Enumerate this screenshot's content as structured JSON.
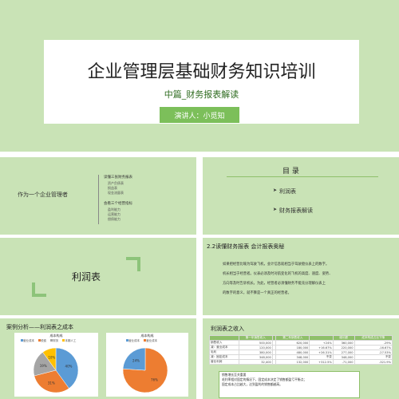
{
  "colors": {
    "slide_bg": "#c9e3b6",
    "title_band": "#a9d08e",
    "accent_green": "#7cbf5a",
    "pie_blue": "#5b9bd5",
    "pie_orange": "#ed7d31",
    "pie_gray": "#a5a5a5",
    "pie_yellow": "#ffc000"
  },
  "title_slide": {
    "title": "企业管理层基础财务知识培训",
    "subtitle": "中篇_财务报表解读",
    "presenter": "演讲人：小觅知"
  },
  "slide2": {
    "heading": "作为一个企业管理者",
    "box1_title": "读懂三张财务报表",
    "box1_items": [
      "资产负债表",
      "损益表",
      "现金流量表"
    ],
    "box2_title": "会看三个经营指标",
    "box2_items": [
      "盈利能力",
      "运营能力",
      "偿债能力"
    ]
  },
  "slide3": {
    "title": "目  录",
    "items": [
      "利润表",
      "财务报表解读"
    ]
  },
  "slide4": {
    "label": "利润表"
  },
  "slide5": {
    "title": "2.2读懂财务报表  会计报表奥秘",
    "paragraphs": [
      "如果把经营比喻为驾驶飞机，会计信息就相当于驾驶舱仪表上的数字。",
      "机长相当于经营者。仪表必须及时对航变化的飞机的高度、速度、姿势、",
      "方向等及时告诉机长。为此，经营者必须懂财务不能充分理解仪表上",
      "的数字的意义，就不算是一个真正的经营者。"
    ]
  },
  "slide6": {
    "title": "案例分析——利润表之成本",
    "pie1": {
      "title": "成本构成",
      "legend": [
        "营业成本",
        "税费",
        "财务",
        "本期人工"
      ],
      "slices": [
        {
          "label": "营业成本",
          "value": 40,
          "display": "40%"
        },
        {
          "label": "税费",
          "value": 31,
          "display": "31%"
        },
        {
          "label": "财务",
          "value": 19,
          "display": "19%"
        },
        {
          "label": "本期人工",
          "value": 10,
          "display": "10%"
        }
      ]
    },
    "pie2": {
      "title": "成本构成",
      "legend": [
        "营业成本",
        "营业成本"
      ],
      "slices": [
        {
          "label": "营业成本",
          "value": 76,
          "display": "76%"
        },
        {
          "label": "营业成本",
          "value": 24,
          "display": "24%"
        }
      ]
    }
  },
  "slide7": {
    "title": "利润表之收入",
    "table": {
      "headers": [
        "",
        "第一年销售收入",
        "",
        "第二年销售收入",
        "",
        "增长额",
        "成本构成占比下降"
      ],
      "rows": [
        [
          "销售收入",
          "500,000",
          "",
          "620,000",
          "+24%",
          "360,000",
          "-29%"
        ],
        [
          "减：营业成本",
          "120,000",
          "",
          "180,000",
          "+16.67%",
          "220,000",
          "-16.67%"
        ],
        [
          "毛利",
          "380,000",
          "",
          "480,000",
          "+26.31%",
          "277,000",
          "-27.53%"
        ],
        [
          "减：固定成本",
          "348,000",
          "",
          "348,000",
          "不变",
          "348,000",
          "不变"
        ],
        [
          "营业利润",
          "32,400",
          "",
          "132,000",
          "+312.5%",
          "-71,000",
          "-321.9%"
        ]
      ]
    },
    "notes": [
      "销售增长至关重要",
      "毛利率相对固定的情况下，固定成本决定了销售额盈亏平衡点；",
      "固定成本占比越大，达到盈利的销售额越高。"
    ]
  }
}
